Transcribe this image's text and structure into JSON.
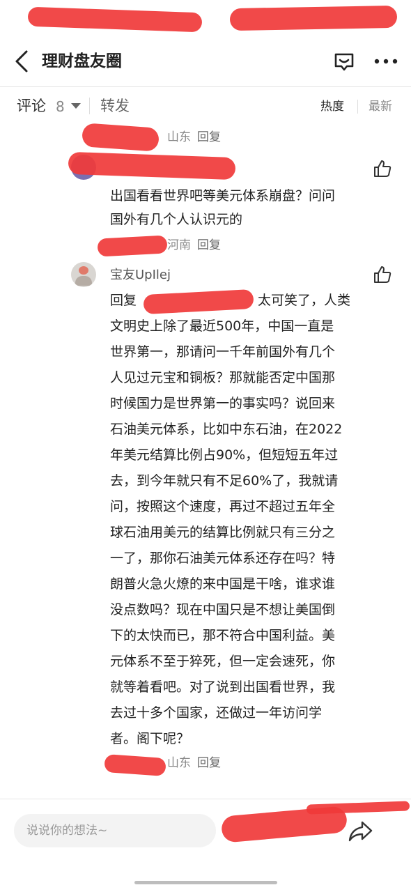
{
  "header": {
    "title": "理财盘友圈"
  },
  "tabs": {
    "comments_label": "评论",
    "comments_count": "8",
    "repost_label": "转发",
    "sort_hot": "热度",
    "sort_new": "最新"
  },
  "thread": {
    "parent_meta": {
      "location": "山东",
      "reply": "回复"
    },
    "comment1": {
      "text_line1": "出国看看世界吧等美元体系崩盘？问问",
      "text_line2": "国外有几个人认识元的",
      "location": "河南",
      "reply": "回复"
    },
    "comment2": {
      "username": "宝友UpIlej",
      "lines": [
        "回复",
        "太可笑了，人类",
        "文明史上除了最近500年，中国一直是",
        "世界第一，那请问一千年前国外有几个",
        "人见过元宝和铜板？那就能否定中国那",
        "时候国力是世界第一的事实吗？说回来",
        "石油美元体系，比如中东石油，在2022",
        "年美元结算比例占90%，但短短五年过",
        "去，到今年就只有不足60%了，我就请",
        "问，按照这个速度，再过不超过五年全",
        "球石油用美元的结算比例就只有三分之",
        "一了，那你石油美元体系还存在吗？特",
        "朗普火急火燎的来中国是干啥，谁求谁",
        "没点数吗？现在中国只是不想让美国倒",
        "下的太快而已，那不符合中国利益。美",
        "元体系不至于猝死，但一定会速死，你",
        "就等着看吧。对了说到出国看世界，我",
        "去过十多个国家，还做过一年访问学",
        "者。阁下呢？"
      ],
      "location": "山东",
      "reply": "回复"
    }
  },
  "bottom": {
    "input_placeholder": "说说你的想法~"
  },
  "colors": {
    "redaction": "#f03a3a",
    "text": "#222222",
    "meta": "#888888"
  },
  "icons": [
    "back-icon",
    "message-icon",
    "more-icon",
    "like-icon",
    "share-icon"
  ]
}
